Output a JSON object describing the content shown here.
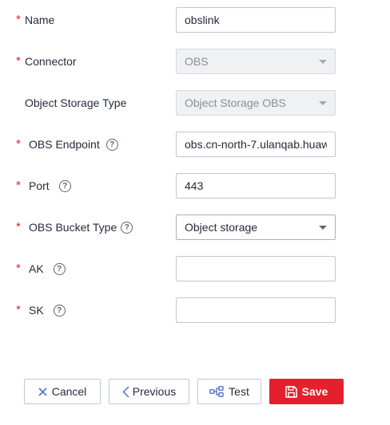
{
  "form": {
    "name": {
      "label": "Name",
      "required": "*",
      "value": "obslink"
    },
    "connector": {
      "label": "Connector",
      "required": "*",
      "value": "OBS"
    },
    "object_storage_type": {
      "label": "Object Storage Type",
      "value": "Object Storage OBS"
    },
    "obs_endpoint": {
      "label": "OBS Endpoint",
      "required": "*",
      "help": "?",
      "value": "obs.cn-north-7.ulanqab.huaw"
    },
    "port": {
      "label": "Port",
      "required": "*",
      "help": "?",
      "value": "443"
    },
    "bucket_type": {
      "label": "OBS Bucket Type",
      "required": "*",
      "help": "?",
      "value": "Object storage"
    },
    "ak": {
      "label": "AK",
      "required": "*",
      "help": "?",
      "value": ""
    },
    "sk": {
      "label": "SK",
      "required": "*",
      "help": "?",
      "value": ""
    }
  },
  "buttons": {
    "cancel": "Cancel",
    "previous": "Previous",
    "test": "Test",
    "save": "Save"
  },
  "colors": {
    "accent": "#e5202d",
    "border": "#c2c6cf",
    "disabled_bg": "#f0f1f3"
  }
}
